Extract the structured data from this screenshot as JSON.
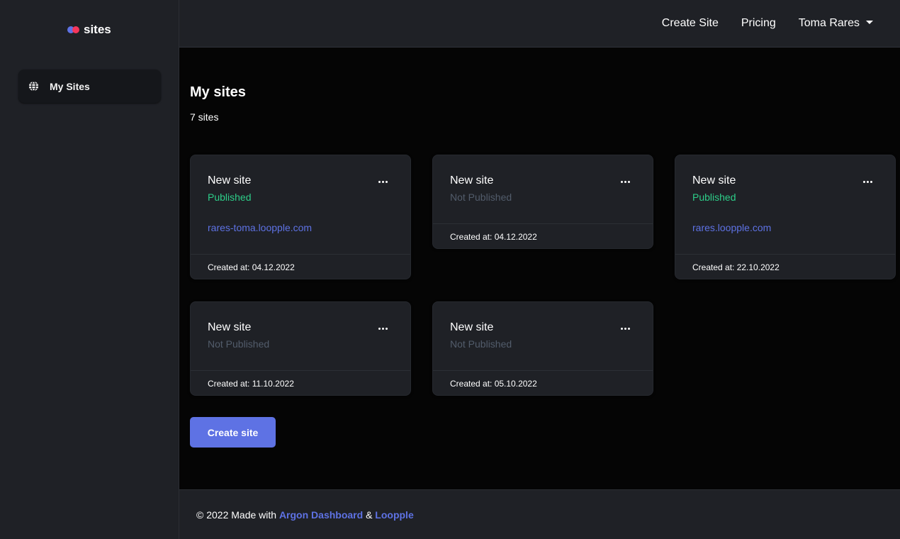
{
  "brand": {
    "name": "sites"
  },
  "sidebar": {
    "items": [
      {
        "label": "My Sites",
        "icon": "globe-icon"
      }
    ]
  },
  "topnav": {
    "create_site": "Create Site",
    "pricing": "Pricing",
    "user_name": "Toma Rares"
  },
  "main": {
    "title": "My sites",
    "count": "7 sites",
    "cards": [
      {
        "title": "New site",
        "status": "Published",
        "link": "rares-toma.loopple.com",
        "created": "Created at: 04.12.2022"
      },
      {
        "title": "New site",
        "status": "Not Published",
        "created": "Created at: 04.12.2022"
      },
      {
        "title": "New site",
        "status": "Published",
        "link": "rares.loopple.com",
        "created": "Created at: 22.10.2022"
      },
      {
        "title": "New site",
        "status": "Not Published",
        "created": "Created at: 11.10.2022"
      },
      {
        "title": "New site",
        "status": "Not Published",
        "created": "Created at: 05.10.2022"
      }
    ],
    "create_button": "Create site"
  },
  "footer": {
    "prefix": "© 2022 Made with",
    "link1": "Argon Dashboard",
    "separator": "&",
    "link2": "Loopple"
  },
  "colors": {
    "accent": "#5e72e4",
    "published": "#2dce89",
    "not_published": "#525c6b",
    "panel": "#1f2126",
    "background": "#050505"
  }
}
